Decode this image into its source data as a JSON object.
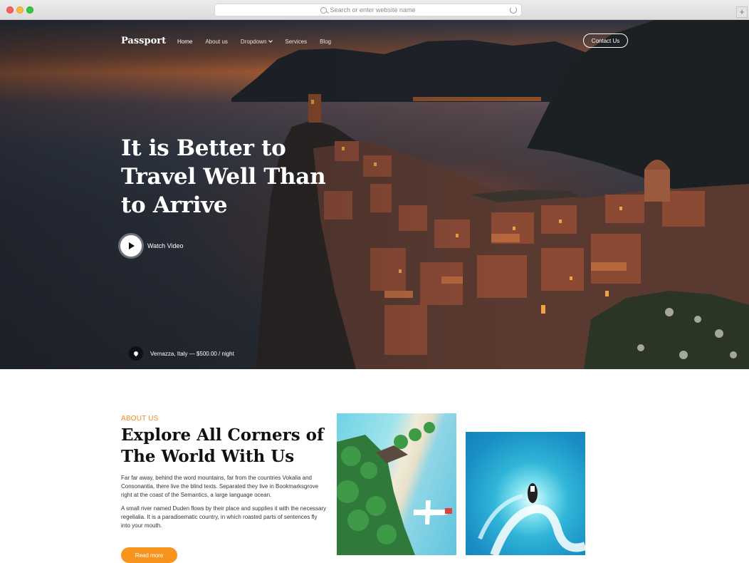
{
  "browser": {
    "url_placeholder": "Search or enter website name",
    "icons": [
      "search-icon",
      "reload-icon",
      "new-tab-icon"
    ]
  },
  "nav": {
    "brand": "Passport",
    "items": [
      {
        "label": "Home",
        "active": true
      },
      {
        "label": "About us",
        "active": false
      },
      {
        "label": "Dropdown",
        "active": false
      },
      {
        "label": "Services",
        "active": false
      },
      {
        "label": "Blog",
        "active": false
      }
    ],
    "contact": "Contact Us"
  },
  "hero": {
    "headline_lines": [
      "It is Better to",
      "Travel Well Than",
      "to Arrive"
    ],
    "watch_label": "Watch Video",
    "location": "Vernazza, Italy — $500.00 / night"
  },
  "about": {
    "tag": "ABOUT US",
    "title_lines": [
      "Explore All Corners of",
      "The World With Us"
    ],
    "para1": "Far far away, behind the word mountains, far from the countries Vokalia and Consonantia, there live the blind texts. Separated they live in Bookmarksgrove right at the coast of the Semantics, a large language ocean.",
    "para2": "A small river named Duden flows by their place and supplies it with the necessary regelialia. It is a paradisematic country, in which roasted parts of sentences fly into your mouth.",
    "cta": "Read more"
  },
  "colors": {
    "accent": "#f7941d",
    "tag": "#f08a24"
  }
}
